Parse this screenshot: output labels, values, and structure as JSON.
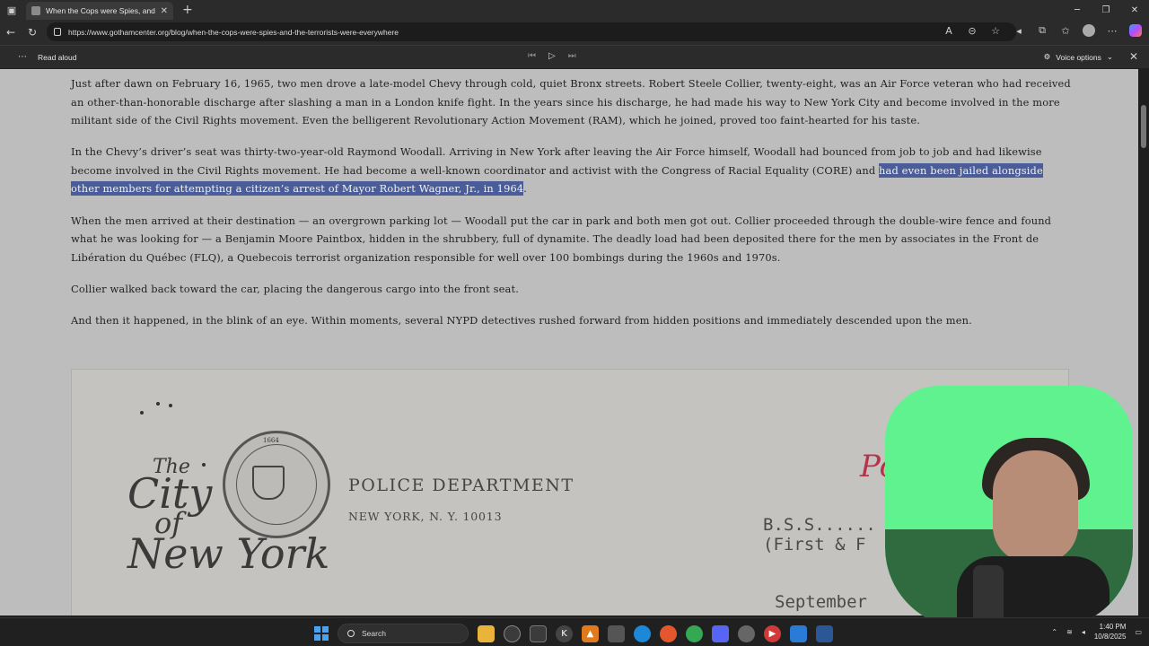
{
  "browser": {
    "tab_title": "When the Cops were Spies, and th",
    "url": "https://www.gothamcenter.org/blog/when-the-cops-were-spies-and-the-terrorists-were-everywhere"
  },
  "read_aloud": {
    "label": "Read aloud",
    "voice_options": "Voice options"
  },
  "article": {
    "p1": "Just after dawn on February 16, 1965, two men drove a late-model Chevy through cold, quiet Bronx streets. Robert Steele Collier, twenty-eight, was an Air Force veteran who had received an other-than-honorable discharge after slashing a man in a London knife fight. In the years since his discharge, he had made his way to New York City and become involved in the more militant side of the Civil Rights movement. Even the belligerent Revolutionary Action Movement (RAM), which he joined, proved too faint-hearted for his taste.",
    "p2_before": "In the Chevy’s driver’s seat was thirty-two-year-old Raymond Woodall. Arriving in New York after leaving the Air Force himself, Woodall had bounced from job to job and had likewise become involved in the Civil Rights movement. He had become a well-known coordinator and activist with the Congress of Racial Equality (CORE) and ",
    "p2_highlight": "had even been jailed alongside other members for attempting a citizen’s arrest of Mayor Robert Wagner, Jr., in 1964",
    "p2_after": ".",
    "p3": "When the men arrived at their destination — an overgrown parking lot — Woodall put the car in park and both men got out. Collier proceeded through the double-wire fence and found what he was looking for — a Benjamin Moore Paintbox, hidden in the shrubbery, full of dynamite. The deadly load had been deposited there for the men by associates in the Front de Libération du Québec (FLQ), a Quebecois terrorist organization responsible for well over 100 bombings during the 1960s and 1970s.",
    "p4": "Collier walked back toward the car, placing the dangerous cargo into the front seat.",
    "p5": "And then it happened, in the blink of an eye. Within moments, several NYPD detectives rushed forward from hidden positions and immediately descended upon the men."
  },
  "document_image": {
    "logo_the": "The",
    "logo_city": "City",
    "logo_of": "of",
    "logo_ny": "New York",
    "seal_year": "1664",
    "department": "POLICE DEPARTMENT",
    "city_line": "NEW YORK, N. Y. 10013",
    "bss_line1": "B.S.S......",
    "bss_line2": "(First & F",
    "date_line": "September",
    "red_mark": "Po"
  },
  "taskbar": {
    "search_label": "Search",
    "time": "1:40 PM",
    "date": "10/8/2025"
  },
  "colors": {
    "highlight": "#4a5d9a",
    "page_bg": "#bdbdbd",
    "webcam_bg": "#5ff28f"
  }
}
